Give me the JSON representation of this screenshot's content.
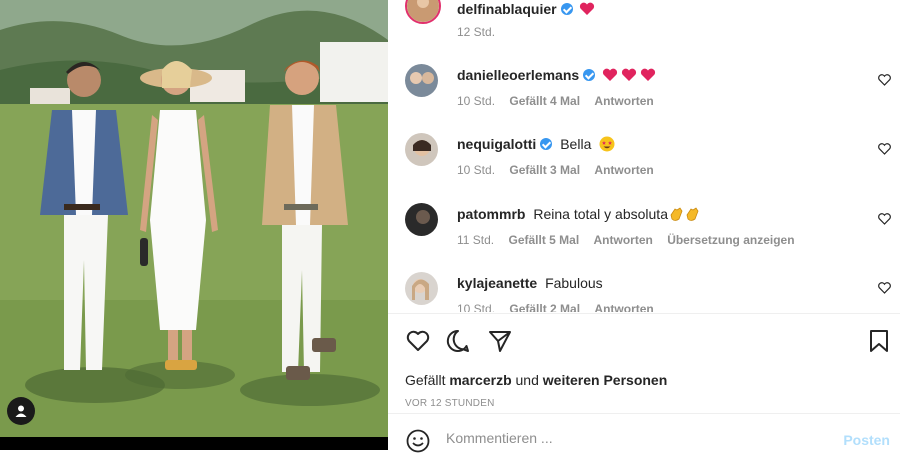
{
  "post": {
    "author": "delfinablaquier",
    "author_verified": true,
    "caption_emoji": "red-heart",
    "time_ago": "12 Std."
  },
  "comments": [
    {
      "username": "danielleoerlemans",
      "verified": true,
      "text": "",
      "emoji": [
        "red-heart",
        "red-heart",
        "red-heart"
      ],
      "time": "10 Std.",
      "likes": "Gefällt 4 Mal",
      "reply": "Antworten",
      "translate": ""
    },
    {
      "username": "nequigalotti",
      "verified": true,
      "text": "Bella",
      "emoji": [
        "star-struck"
      ],
      "time": "10 Std.",
      "likes": "Gefällt 3 Mal",
      "reply": "Antworten",
      "translate": ""
    },
    {
      "username": "patommrb",
      "verified": false,
      "text": "Reina total y absoluta",
      "emoji": [
        "clapping-hands",
        "clapping-hands"
      ],
      "time": "11 Std.",
      "likes": "Gefällt 5 Mal",
      "reply": "Antworten",
      "translate": "Übersetzung anzeigen"
    },
    {
      "username": "kylajeanette",
      "verified": false,
      "text": "Fabulous",
      "emoji": [],
      "time": "10 Std.",
      "likes": "Gefällt 2 Mal",
      "reply": "Antworten",
      "translate": ""
    }
  ],
  "likes_line": {
    "prefix": "Gefällt",
    "user": "marcerzb",
    "joiner": "und",
    "others": "weiteren Personen"
  },
  "timestamp": "VOR 12 STUNDEN",
  "compose": {
    "placeholder": "Kommentieren ...",
    "post_label": "Posten"
  },
  "colors": {
    "verified": "#3897f0",
    "red_heart": "#e0245e",
    "post_disabled": "#b2dffc",
    "muted": "#8e8e8e",
    "text": "#262626"
  },
  "icons": {
    "actions": [
      "heart-outline-icon",
      "comment-icon",
      "share-icon",
      "bookmark-icon"
    ],
    "comment_like": "heart-outline-icon",
    "compose": "emoji-icon",
    "photo": "user-tag-icon"
  }
}
